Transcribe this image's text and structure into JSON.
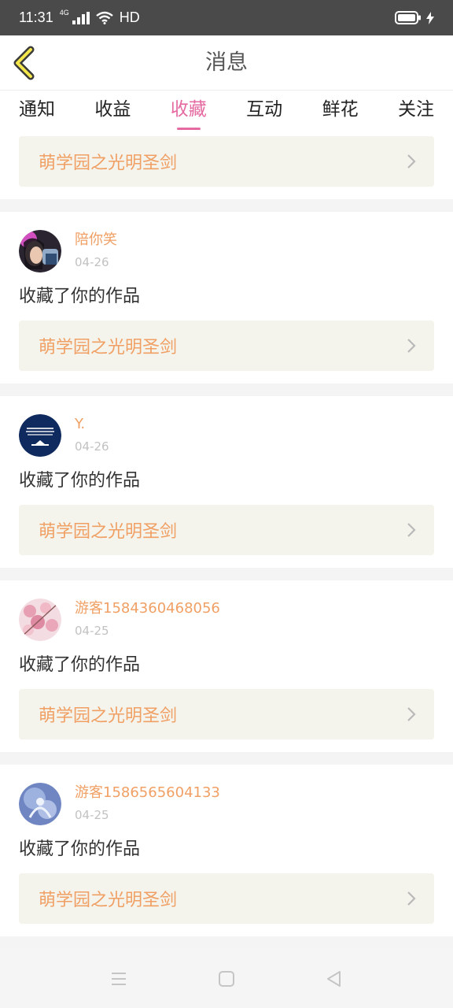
{
  "status_bar": {
    "time": "11:31",
    "network": "4G",
    "hd": "HD"
  },
  "header": {
    "title": "消息"
  },
  "tabs": [
    {
      "label": "通知"
    },
    {
      "label": "收益"
    },
    {
      "label": "收藏",
      "active": true
    },
    {
      "label": "互动"
    },
    {
      "label": "鲜花"
    },
    {
      "label": "关注"
    }
  ],
  "first_item": {
    "work_title": "萌学园之光明圣剑"
  },
  "items": [
    {
      "user": "陪你笑",
      "date": "04-26",
      "action": "收藏了你的作品",
      "work_title": "萌学园之光明圣剑"
    },
    {
      "user": "Y.",
      "date": "04-26",
      "action": "收藏了你的作品",
      "work_title": "萌学园之光明圣剑"
    },
    {
      "user": "游客1584360468056",
      "date": "04-25",
      "action": "收藏了你的作品",
      "work_title": "萌学园之光明圣剑"
    },
    {
      "user": "游客1586565604133",
      "date": "04-25",
      "action": "收藏了你的作品",
      "work_title": "萌学园之光明圣剑"
    }
  ],
  "colors": {
    "accent": "#e56aa1",
    "username": "#f0a064",
    "work_title": "#f0a064",
    "date": "#c2c2c2",
    "link_bg": "#f4f3ec"
  },
  "icons": {
    "back": "chevron-left-icon",
    "link": "chevron-right-icon",
    "nav": [
      "menu-icon",
      "home-icon",
      "back-triangle-icon"
    ]
  }
}
